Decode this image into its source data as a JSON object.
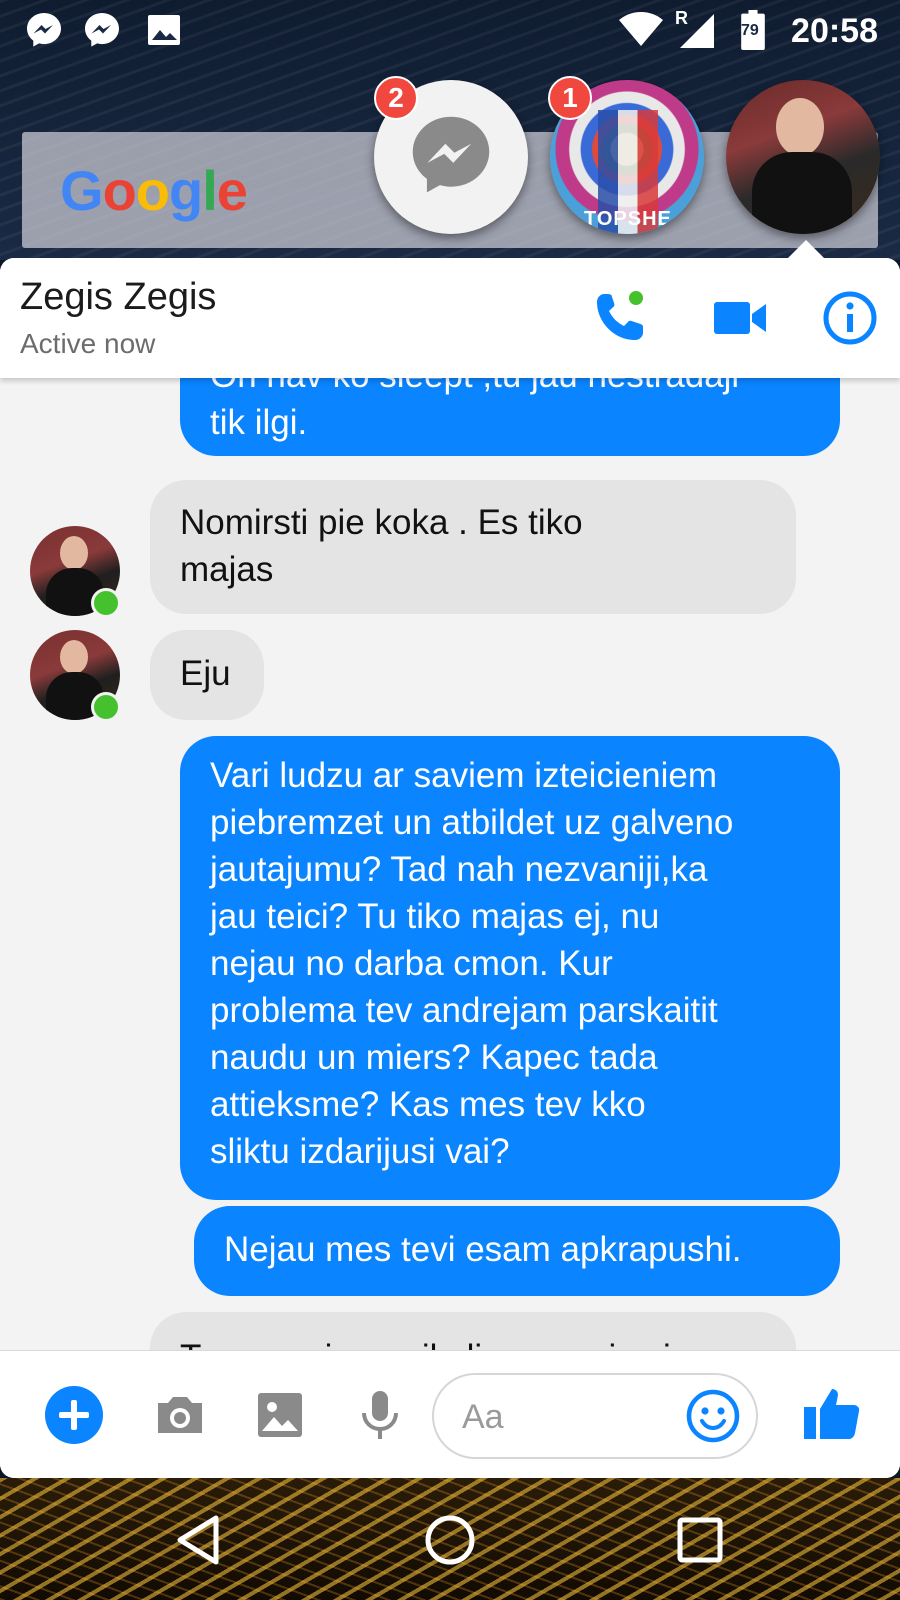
{
  "status_bar": {
    "time": "20:58",
    "battery_level": "79",
    "signal_roaming": "R",
    "notification_icons": [
      "messenger-icon",
      "messenger-icon",
      "image-icon"
    ]
  },
  "google_widget": {
    "logo": "Google",
    "letters": [
      "G",
      "o",
      "o",
      "g",
      "l",
      "e"
    ]
  },
  "chat_heads": [
    {
      "name": "messenger-chat-head",
      "badge": "2"
    },
    {
      "name": "group-chat-head",
      "badge": "1",
      "caption": "TOPSHE"
    },
    {
      "name": "zegis-chat-head",
      "badge": ""
    }
  ],
  "conversation": {
    "contact_name": "Zegis Zegis",
    "status": "Active now"
  },
  "messages": [
    {
      "direction": "out",
      "lines": [
        "On nav ko sleept ,tu jau nestradaji",
        "tik ilgi."
      ]
    },
    {
      "direction": "in",
      "lines": [
        "Nomirsti pie koka .  Es tiko",
        "majas"
      ]
    },
    {
      "direction": "in",
      "lines": [
        "Eju"
      ]
    },
    {
      "direction": "out",
      "lines": [
        "Vari ludzu ar saviem izteicieniem",
        "piebremzet un atbildet uz galveno",
        "jautajumu? Tad nah nezvaniji,ka",
        "jau teici? Tu tiko majas ej, nu",
        "nejau no darba cmon. Kur",
        "problema tev andrejam parskaitit",
        "naudu un miers? Kapec tada",
        "attieksme? Kas mes tev kko",
        "sliktu izdarijusi vai?"
      ]
    },
    {
      "direction": "out",
      "lines": [
        "Nejau mes tevi esam apkrapushi."
      ]
    },
    {
      "direction": "in",
      "lines": [
        "Tu ar saviem prikoliem mani esi"
      ]
    }
  ],
  "composer": {
    "placeholder": "Aa"
  },
  "colors": {
    "accent": "#0a84ff",
    "outgoing_bubble": "#0a84ff",
    "incoming_bubble": "#e4e4e4",
    "badge": "#f0483e",
    "online": "#45c12d"
  }
}
